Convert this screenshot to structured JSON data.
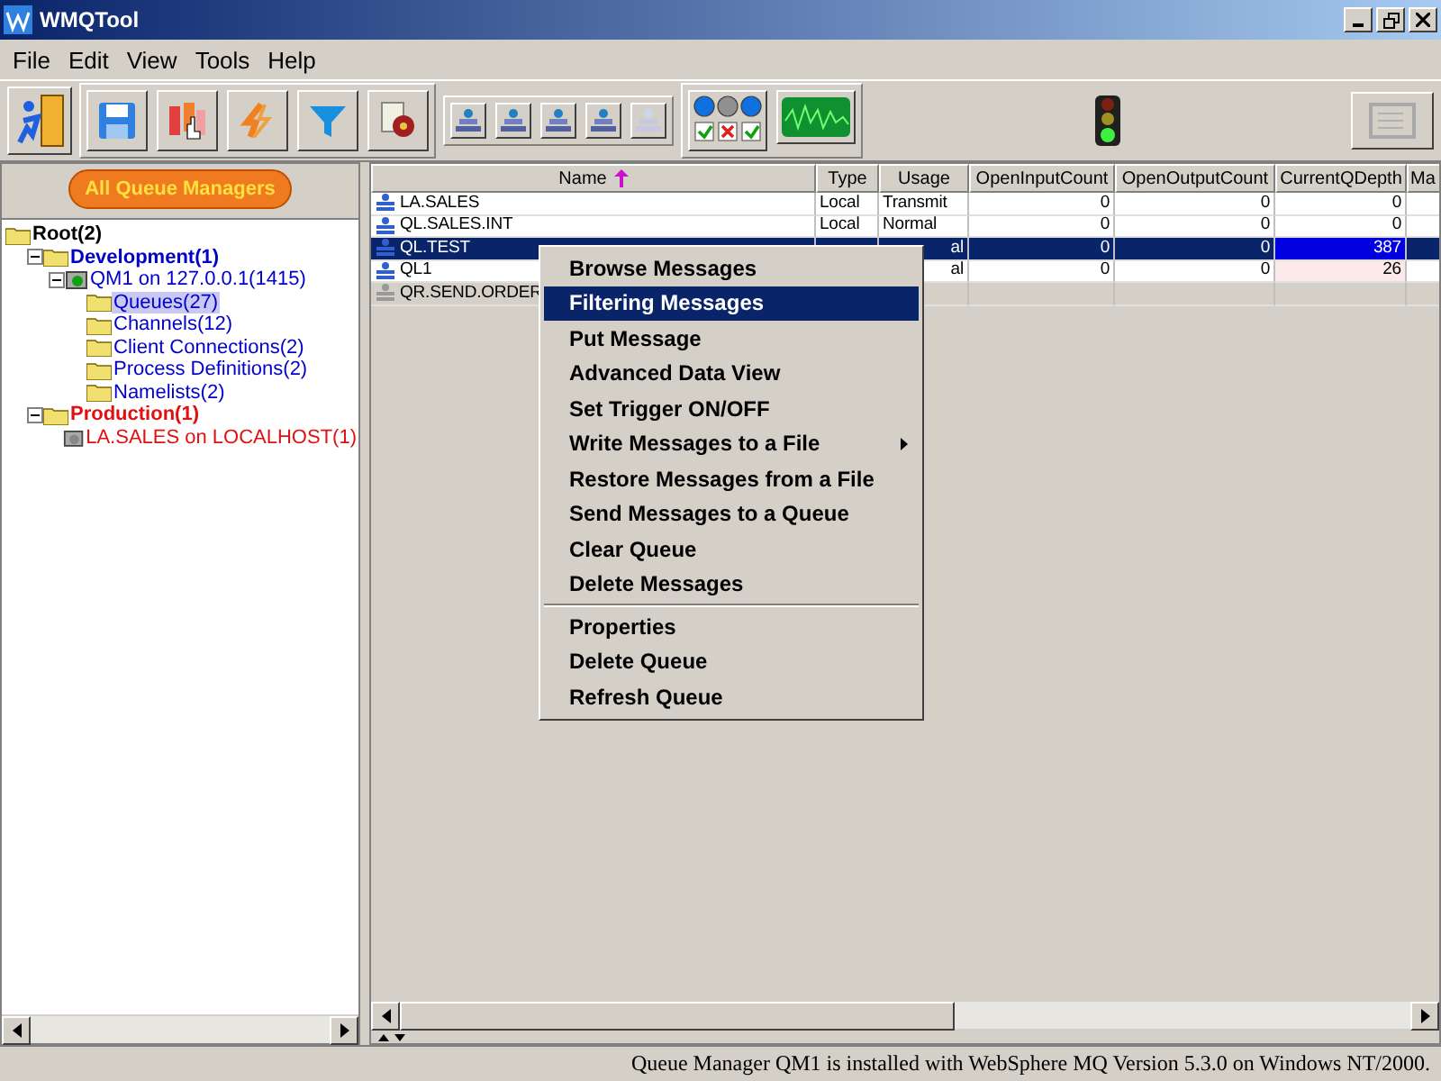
{
  "window": {
    "title": "WMQTool"
  },
  "menu_bar": [
    "File",
    "Edit",
    "View",
    "Tools",
    "Help"
  ],
  "toolbar": {
    "status_lights": [
      {
        "on": true,
        "ok": true
      },
      {
        "on": false,
        "ok": false
      },
      {
        "on": true,
        "ok": true
      }
    ]
  },
  "sidebar": {
    "button": "All Queue Managers",
    "tree": [
      {
        "label": "Root(2)",
        "kind": "folder",
        "color": "#000000",
        "bold": true,
        "selected": false,
        "children": [
          {
            "label": "Development(1)",
            "kind": "folder",
            "color": "#0000cc",
            "bold": true,
            "expanded": true,
            "selected": false,
            "children": [
              {
                "label": "QM1 on 127.0.0.1(1415)",
                "kind": "manager",
                "color": "#0000cc",
                "bold": false,
                "expanded": true,
                "selected": false,
                "children": [
                  {
                    "label": "Queues(27)",
                    "kind": "folder",
                    "color": "#0000cc",
                    "bold": false,
                    "selected": true
                  },
                  {
                    "label": "Channels(12)",
                    "kind": "folder",
                    "color": "#0000cc",
                    "bold": false,
                    "selected": false
                  },
                  {
                    "label": "Client Connections(2)",
                    "kind": "folder",
                    "color": "#0000cc",
                    "bold": false,
                    "selected": false
                  },
                  {
                    "label": "Process Definitions(2)",
                    "kind": "folder",
                    "color": "#0000cc",
                    "bold": false,
                    "selected": false
                  },
                  {
                    "label": "Namelists(2)",
                    "kind": "folder",
                    "color": "#0000cc",
                    "bold": false,
                    "selected": false
                  }
                ]
              }
            ]
          },
          {
            "label": "Production(1)",
            "kind": "folder",
            "color": "#e01010",
            "bold": true,
            "expanded": true,
            "selected": false,
            "children": [
              {
                "label": "LA.SALES on LOCALHOST(1)",
                "kind": "manager-off",
                "color": "#e01010",
                "bold": false,
                "selected": false
              }
            ]
          }
        ]
      }
    ]
  },
  "table": {
    "columns": [
      {
        "label": "Name",
        "sorted": true
      },
      {
        "label": "Type",
        "sorted": false
      },
      {
        "label": "Usage",
        "sorted": false
      },
      {
        "label": "OpenInputCount",
        "sorted": false
      },
      {
        "label": "OpenOutputCount",
        "sorted": false
      },
      {
        "label": "CurrentQDepth",
        "sorted": false
      },
      {
        "label": "Ma",
        "sorted": false
      }
    ],
    "rows": [
      {
        "name": "LA.SALES",
        "type": "Local",
        "usage": "Transmit",
        "open_input": "0",
        "open_output": "0",
        "depth": "0",
        "selected": false,
        "depth_alert": false
      },
      {
        "name": "QL.SALES.INT",
        "type": "Local",
        "usage": "Normal",
        "open_input": "0",
        "open_output": "0",
        "depth": "0",
        "selected": false,
        "depth_alert": false
      },
      {
        "name": "QL.TEST",
        "usage": "al",
        "open_input": "0",
        "open_output": "0",
        "depth": "387",
        "selected": true,
        "depth_alert": true
      },
      {
        "name": "QL1",
        "usage": "al",
        "open_input": "0",
        "open_output": "0",
        "depth": "26",
        "selected": false,
        "depth_alert": true
      },
      {
        "name": "QR.SEND.ORDER",
        "kind": "remote",
        "selected": false,
        "depth_alert": false
      }
    ]
  },
  "context_menu": {
    "groups": [
      [
        {
          "label": "Browse Messages",
          "selected": false,
          "submenu": false
        },
        {
          "label": "Filtering Messages",
          "selected": true,
          "submenu": false
        },
        {
          "label": "Put Message",
          "selected": false,
          "submenu": false
        },
        {
          "label": "Advanced Data View",
          "selected": false,
          "submenu": false
        },
        {
          "label": "Set Trigger ON/OFF",
          "selected": false,
          "submenu": false
        },
        {
          "label": "Write Messages to a File",
          "selected": false,
          "submenu": true
        },
        {
          "label": "Restore Messages from a File",
          "selected": false,
          "submenu": false
        },
        {
          "label": "Send Messages to a Queue",
          "selected": false,
          "submenu": false
        },
        {
          "label": "Clear Queue",
          "selected": false,
          "submenu": false
        },
        {
          "label": "Delete Messages",
          "selected": false,
          "submenu": false
        }
      ],
      [
        {
          "label": "Properties",
          "selected": false,
          "submenu": false
        },
        {
          "label": "Delete Queue",
          "selected": false,
          "submenu": false
        },
        {
          "label": "Refresh Queue",
          "selected": false,
          "submenu": false
        }
      ]
    ]
  },
  "status_bar": "Queue Manager QM1 is installed with WebSphere MQ Version 5.3.0 on Windows NT/2000."
}
